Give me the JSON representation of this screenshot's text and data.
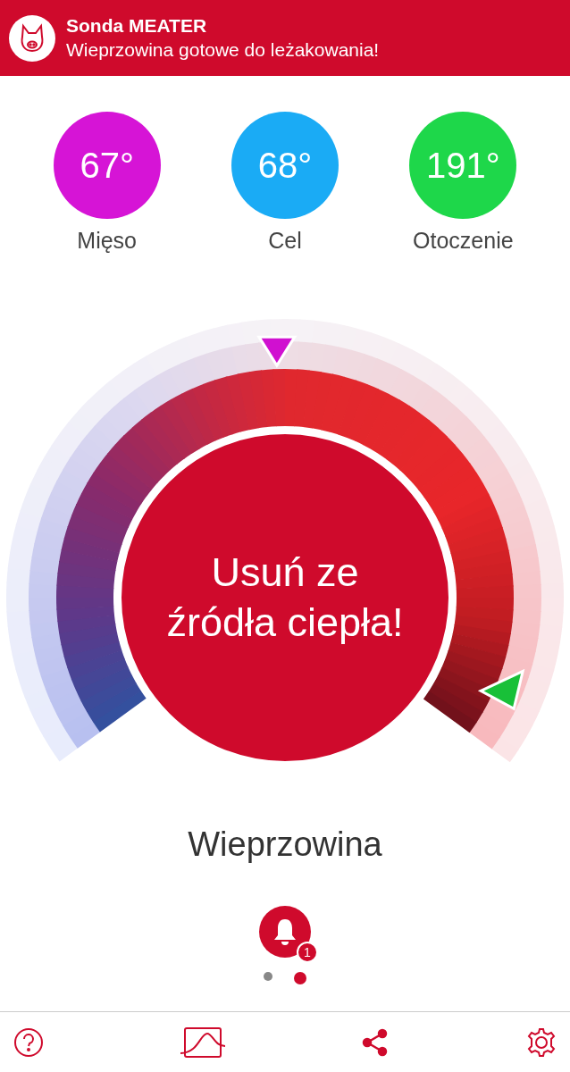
{
  "notification": {
    "title": "Sonda MEATER",
    "message": "Wieprzowina gotowe do leżakowania!"
  },
  "temperatures": [
    {
      "value": "67°",
      "label": "Mięso",
      "color": "#d614d6"
    },
    {
      "value": "68°",
      "label": "Cel",
      "color": "#1aabf5"
    },
    {
      "value": "191°",
      "label": "Otoczenie",
      "color": "#1ed74a"
    }
  ],
  "gauge": {
    "message_lines": [
      "Usuń ze",
      "źródła ciepła!"
    ]
  },
  "meat_type": "Wieprzowina",
  "alerts": {
    "badge": "1"
  },
  "pages": [
    {
      "selected": false
    },
    {
      "selected": true
    }
  ]
}
